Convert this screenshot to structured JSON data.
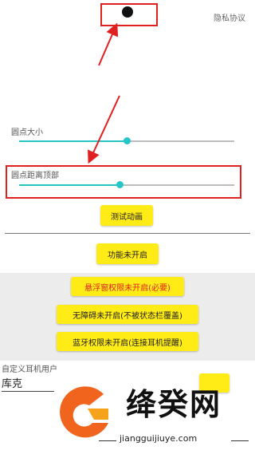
{
  "header": {
    "privacy_link": "隐私协议"
  },
  "sliders": [
    {
      "label": "圆点大小",
      "value_fraction": 0.5
    },
    {
      "label": "圆点距离顶部",
      "value_fraction": 0.46
    }
  ],
  "buttons": {
    "test_animation": "测试动画",
    "function_disabled": "功能未开启",
    "float_permission": "悬浮窗权限未开启(必要)",
    "accessibility": "无障碍未开启(不被状态栏覆盖)",
    "bluetooth": "蓝牙权限未开启(连接耳机提醒)"
  },
  "custom_earphone": {
    "label": "自定义耳机用户",
    "value": "库克"
  },
  "watermark": {
    "title": "绛癸网",
    "url": "jiangguijiuye.com"
  },
  "colors": {
    "accent": "#26c6c6",
    "button": "#ffeb16",
    "annotation": "#e02020",
    "warning_text": "#e02020",
    "watermark_orange": "#f0641e"
  }
}
